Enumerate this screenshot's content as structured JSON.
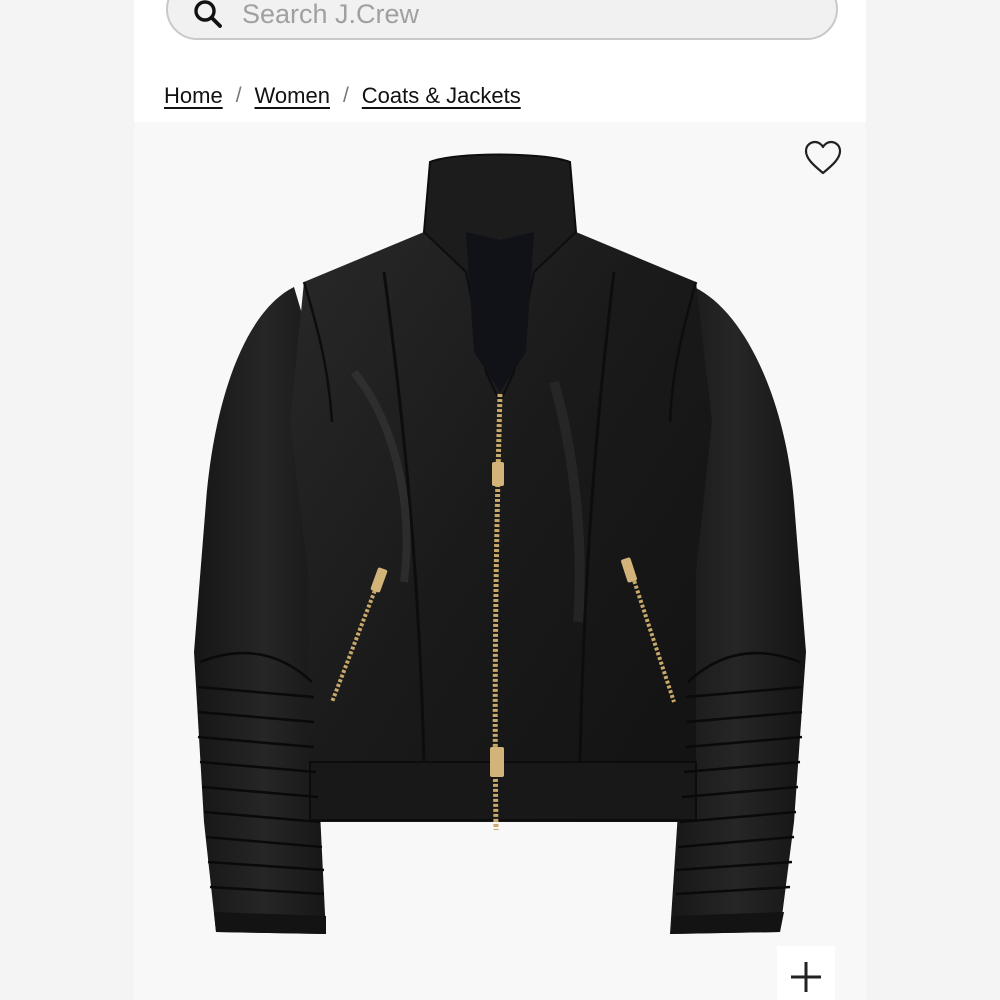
{
  "search": {
    "placeholder": "Search J.Crew"
  },
  "breadcrumb": {
    "items": [
      {
        "label": "Home"
      },
      {
        "label": "Women"
      },
      {
        "label": "Coats & Jackets"
      }
    ],
    "separator": "/"
  },
  "product": {
    "image_icon": "black-leather-moto-jacket",
    "wishlist_icon": "heart-icon",
    "zoom_icon": "plus-icon"
  },
  "colors": {
    "jacket": "#1d1d1d",
    "zipper": "#c8a96a",
    "background": "#f4f4f4"
  }
}
